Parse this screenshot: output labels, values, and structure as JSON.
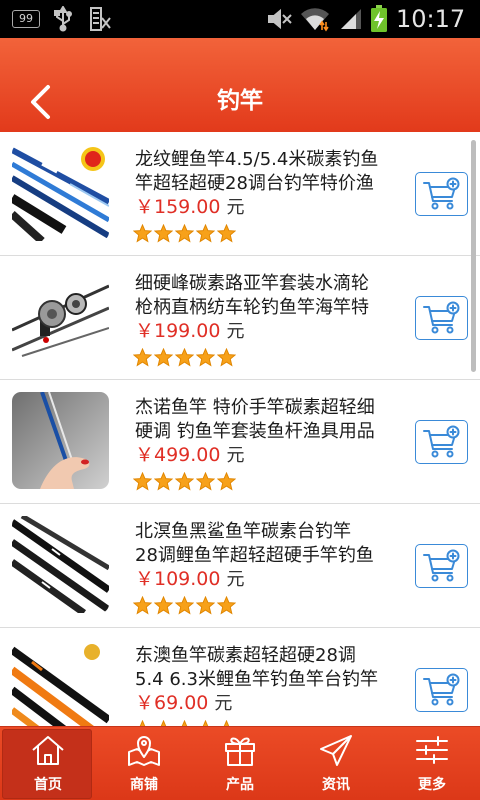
{
  "status_bar": {
    "notification_count": "99",
    "time": "10:17",
    "icons": [
      "notification-count-icon",
      "usb-icon",
      "document-icon",
      "mute-icon",
      "wifi-icon",
      "signal-icon",
      "battery-charging-icon"
    ]
  },
  "header": {
    "title": "钓竿",
    "back_icon": "back-arrow-icon"
  },
  "products": [
    {
      "title_lines": [
        "龙纹鲤鱼竿4.5/5.4米碳素钓鱼",
        "竿超轻超硬28调台钓竿特价渔"
      ],
      "price": "￥159.00",
      "unit": "元",
      "rating": 5,
      "cart_icon": "add-to-cart-icon"
    },
    {
      "title_lines": [
        "细硬峰碳素路亚竿套装水滴轮",
        "枪柄直柄纺车轮钓鱼竿海竿特"
      ],
      "price": "￥199.00",
      "unit": "元",
      "rating": 5,
      "cart_icon": "add-to-cart-icon"
    },
    {
      "title_lines": [
        "杰诺鱼竿 特价手竿碳素超轻细",
        "硬调 钓鱼竿套装鱼杆渔具用品"
      ],
      "price": "￥499.00",
      "unit": "元",
      "rating": 5,
      "cart_icon": "add-to-cart-icon"
    },
    {
      "title_lines": [
        "北溟鱼黑鲨鱼竿碳素台钓竿",
        "28调鲤鱼竿超轻超硬手竿钓鱼"
      ],
      "price": "￥109.00",
      "unit": "元",
      "rating": 5,
      "cart_icon": "add-to-cart-icon"
    },
    {
      "title_lines": [
        "东澳鱼竿碳素超轻超硬28调",
        "5.4 6.3米鲤鱼竿钓鱼竿台钓竿"
      ],
      "price": "￥69.00",
      "unit": "元",
      "rating": 5,
      "cart_icon": "add-to-cart-icon"
    }
  ],
  "bottom_nav": {
    "items": [
      {
        "label": "首页",
        "icon": "home-icon",
        "active": true
      },
      {
        "label": "商铺",
        "icon": "map-pin-icon",
        "active": false
      },
      {
        "label": "产品",
        "icon": "gift-icon",
        "active": false
      },
      {
        "label": "资讯",
        "icon": "paper-plane-icon",
        "active": false
      },
      {
        "label": "更多",
        "icon": "sliders-icon",
        "active": false
      }
    ]
  },
  "colors": {
    "header": "#e8461f",
    "price": "#e02f26",
    "star": "#f7a11a",
    "cart": "#3a8ad8",
    "nav": "#dc3818",
    "nav_active": "#c4301a",
    "battery": "#6fc32b"
  }
}
